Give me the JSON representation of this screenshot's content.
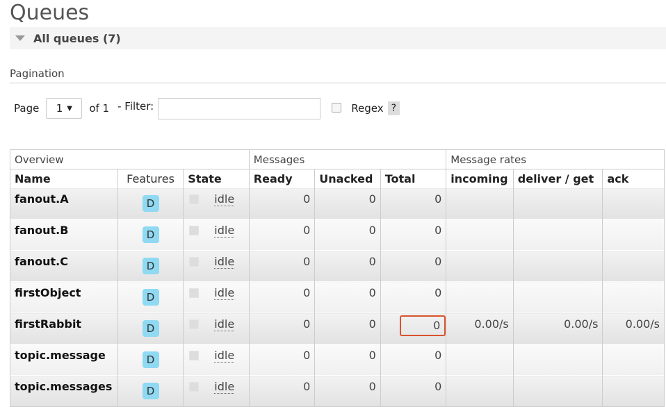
{
  "page": {
    "title": "Queues"
  },
  "section": {
    "label": "All queues (7)"
  },
  "pagination": {
    "heading": "Pagination",
    "page_label": "Page",
    "page_value": "1",
    "of_label": "of 1",
    "filter_label": "- Filter:",
    "filter_value": "",
    "regex_label": "Regex",
    "help_label": "?"
  },
  "table": {
    "groups": [
      "Overview",
      "Messages",
      "Message rates"
    ],
    "columns": [
      "Name",
      "Features",
      "State",
      "Ready",
      "Unacked",
      "Total",
      "incoming",
      "deliver / get",
      "ack"
    ],
    "rows": [
      {
        "name": "fanout.A",
        "feature": "D",
        "state": "idle",
        "ready": "0",
        "unacked": "0",
        "total": "0",
        "incoming": "",
        "deliver": "",
        "ack": ""
      },
      {
        "name": "fanout.B",
        "feature": "D",
        "state": "idle",
        "ready": "0",
        "unacked": "0",
        "total": "0",
        "incoming": "",
        "deliver": "",
        "ack": ""
      },
      {
        "name": "fanout.C",
        "feature": "D",
        "state": "idle",
        "ready": "0",
        "unacked": "0",
        "total": "0",
        "incoming": "",
        "deliver": "",
        "ack": ""
      },
      {
        "name": "firstObject",
        "feature": "D",
        "state": "idle",
        "ready": "0",
        "unacked": "0",
        "total": "0",
        "incoming": "",
        "deliver": "",
        "ack": ""
      },
      {
        "name": "firstRabbit",
        "feature": "D",
        "state": "idle",
        "ready": "0",
        "unacked": "0",
        "total": "0",
        "incoming": "0.00/s",
        "deliver": "0.00/s",
        "ack": "0.00/s"
      },
      {
        "name": "topic.message",
        "feature": "D",
        "state": "idle",
        "ready": "0",
        "unacked": "0",
        "total": "0",
        "incoming": "",
        "deliver": "",
        "ack": ""
      },
      {
        "name": "topic.messages",
        "feature": "D",
        "state": "idle",
        "ready": "0",
        "unacked": "0",
        "total": "0",
        "incoming": "",
        "deliver": "",
        "ack": ""
      }
    ]
  },
  "colors": {
    "feature_badge": "#8fd9f2",
    "highlight": "#d9532c"
  }
}
